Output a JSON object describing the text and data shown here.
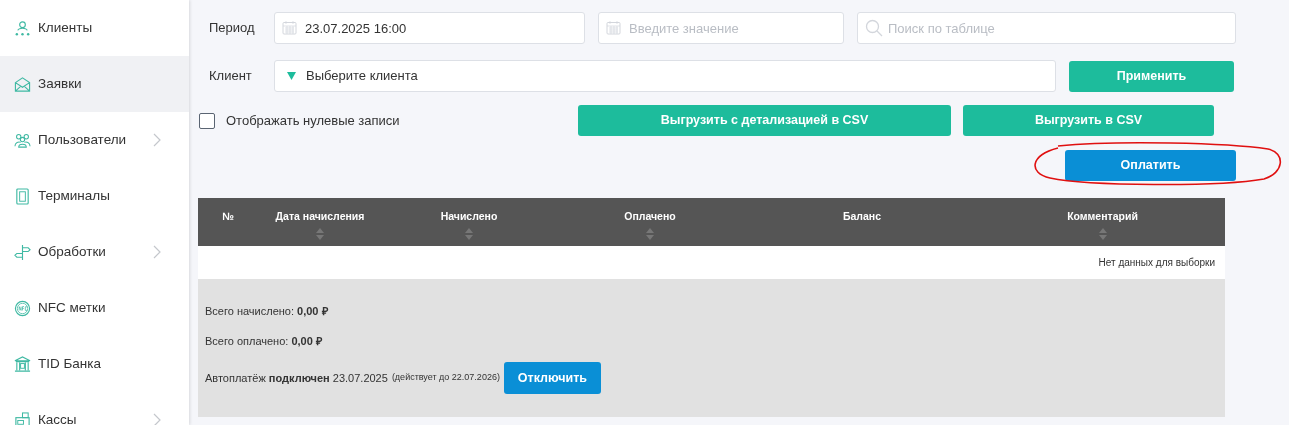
{
  "sidebar": {
    "items": [
      {
        "label": "Клиенты",
        "selected": false,
        "has_submenu": false
      },
      {
        "label": "Заявки",
        "selected": true,
        "has_submenu": false
      },
      {
        "label": "Пользователи",
        "selected": false,
        "has_submenu": true
      },
      {
        "label": "Терминалы",
        "selected": false,
        "has_submenu": false
      },
      {
        "label": "Обработки",
        "selected": false,
        "has_submenu": true
      },
      {
        "label": "NFC метки",
        "selected": false,
        "has_submenu": false
      },
      {
        "label": "TID Банка",
        "selected": false,
        "has_submenu": false
      },
      {
        "label": "Кассы",
        "selected": false,
        "has_submenu": true
      }
    ]
  },
  "filters": {
    "period_label": "Период",
    "period_from": {
      "value": "23.07.2025 16:00"
    },
    "period_to": {
      "placeholder": "Введите значение"
    },
    "search": {
      "placeholder": "Поиск по таблице"
    },
    "client_label": "Клиент",
    "client_select": {
      "placeholder": "Выберите клиента"
    },
    "apply_button": "Применить",
    "show_zero": {
      "label": "Отображать нулевые записи",
      "checked": false
    },
    "export_detailed_button": "Выгрузить с детализацией в CSV",
    "export_button": "Выгрузить в CSV",
    "pay_button": "Оплатить"
  },
  "annotation": {
    "kind": "ellipse"
  },
  "table": {
    "columns": [
      {
        "label": "№",
        "sortable": false
      },
      {
        "label": "Дата начисления",
        "sortable": true
      },
      {
        "label": "Начислено",
        "sortable": true
      },
      {
        "label": "Оплачено",
        "sortable": true
      },
      {
        "label": "Баланс",
        "sortable": false
      },
      {
        "label": "Комментарий",
        "sortable": true
      }
    ],
    "empty_message": "Нет данных для выборки"
  },
  "summary": {
    "total_charged": "Всего начислено: **0,00 ₽**",
    "total_paid": "Всего оплачено: **0,00 ₽**",
    "autopay": "Автоплатёж **подключен** 23.07.2025",
    "autopay_note": "(действует до 22.07.2026)",
    "disable_button": "Отключить"
  }
}
